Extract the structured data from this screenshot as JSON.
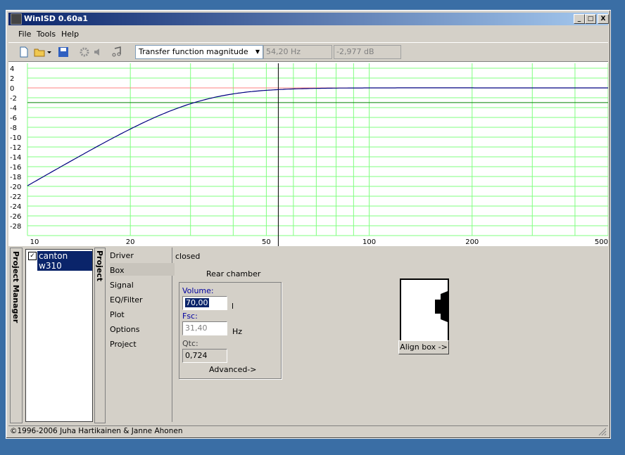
{
  "window": {
    "title": "WinISD 0.60a1",
    "buttons": {
      "minimize": "_",
      "maximize": "□",
      "close": "X"
    }
  },
  "menu": {
    "file": "File",
    "tools": "Tools",
    "help": "Help"
  },
  "toolbar": {
    "plot_type": "Transfer function magnitude",
    "cursor_freq": "54,20 Hz",
    "cursor_level": "-2,977 dB"
  },
  "chart_data": {
    "type": "line",
    "x_scale": "log",
    "xlim": [
      10,
      500
    ],
    "ylim": [
      -30,
      5
    ],
    "x_ticks": [
      "10",
      "20",
      "50",
      "100",
      "200",
      "500"
    ],
    "y_ticks": [
      "4",
      "2",
      "0",
      "-2",
      "-4",
      "-6",
      "-8",
      "-10",
      "-12",
      "-14",
      "-16",
      "-18",
      "-20",
      "-22",
      "-24",
      "-26",
      "-28"
    ],
    "grid": true,
    "cursor": {
      "x": 54.2,
      "y": -2.977
    },
    "reference_line_y": 0,
    "series": [
      {
        "color": "#000080",
        "fc": 31.4,
        "qtc": 0.724
      }
    ]
  },
  "project_manager": {
    "tab_label": "Project Manager",
    "projects": [
      {
        "label": "canton w310",
        "checked": true
      }
    ]
  },
  "project_tab_label": "Project",
  "nav": {
    "items": [
      "Driver",
      "Box",
      "Signal",
      "EQ/Filter",
      "Plot",
      "Options",
      "Project"
    ],
    "selected": "Box"
  },
  "box_page": {
    "type_label": "closed",
    "group_title": "Rear chamber",
    "volume_label": "Volume:",
    "volume_value": "70,00",
    "volume_unit": "l",
    "fsc_label": "Fsc:",
    "fsc_value": "31,40",
    "fsc_unit": "Hz",
    "qtc_label": "Qtc:",
    "qtc_value": "0,724",
    "advanced_label": "Advanced->",
    "align_label": "Align box ->"
  },
  "status": {
    "copyright": "©1996-2006 Juha Hartikainen & Janne Ahonen"
  }
}
